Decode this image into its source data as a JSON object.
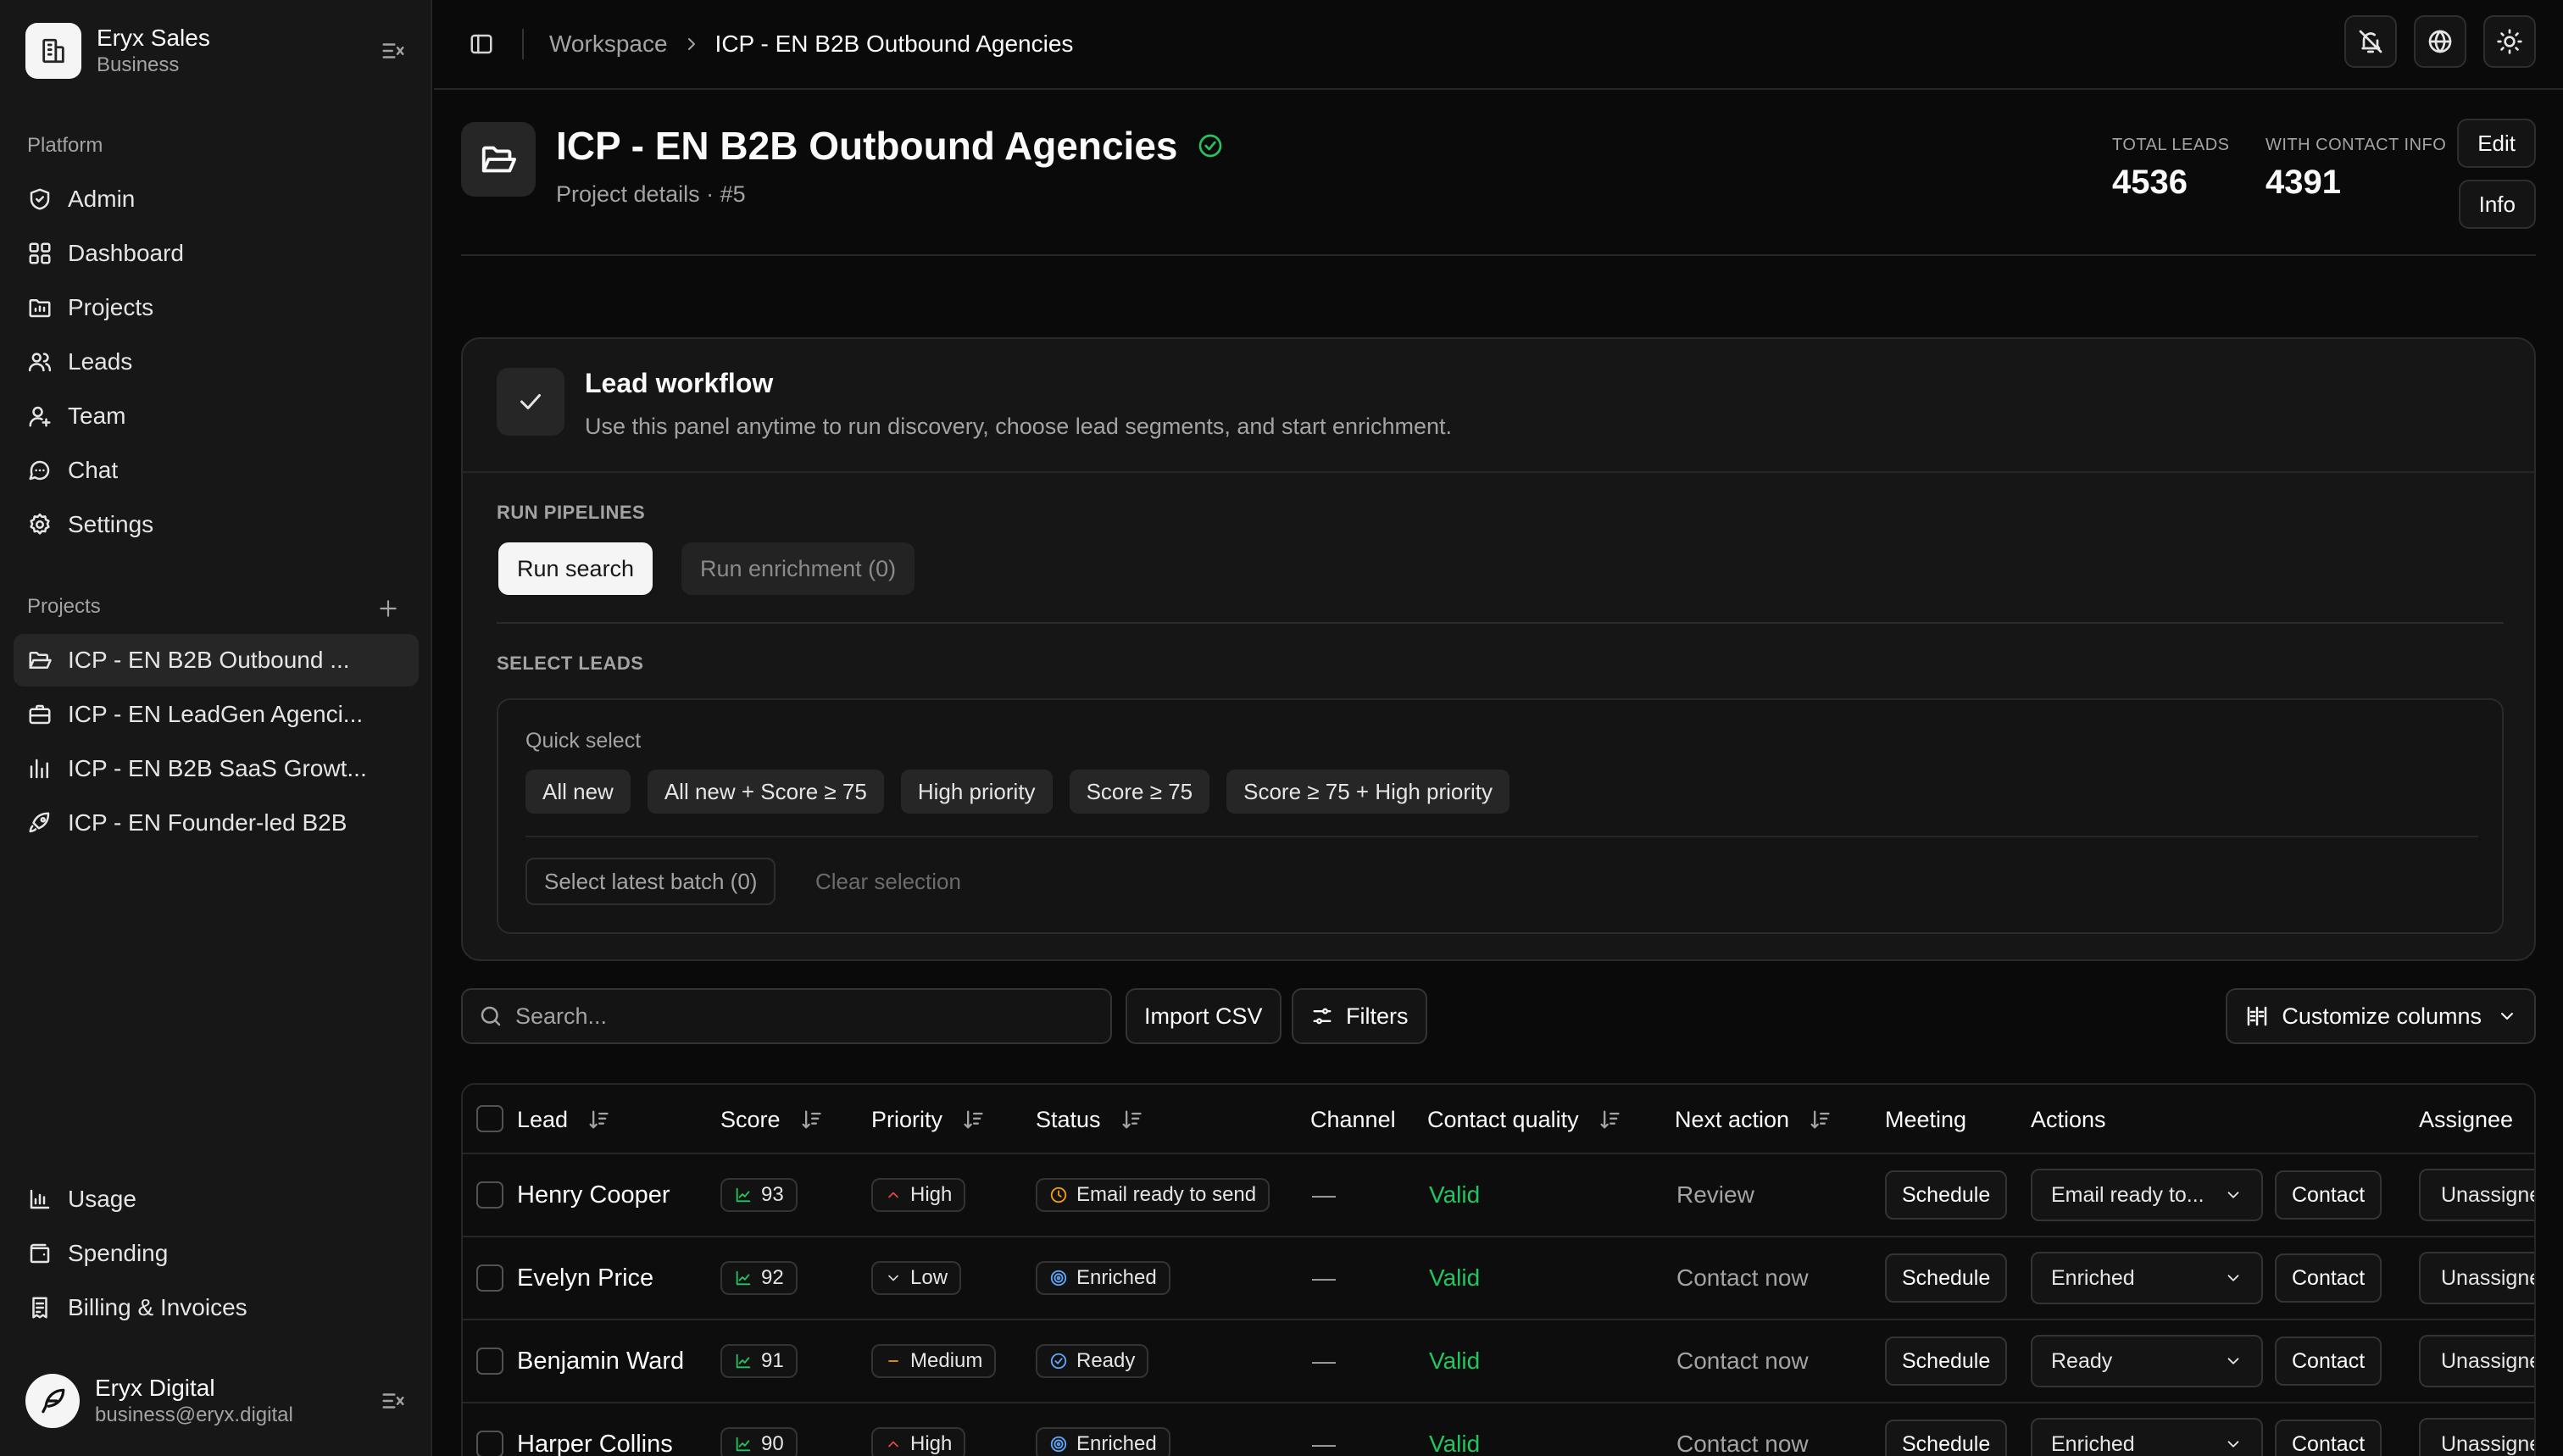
{
  "brand": {
    "name": "Eryx Sales",
    "plan": "Business"
  },
  "platform": {
    "label": "Platform",
    "items": [
      {
        "label": "Admin",
        "icon": "shield-check-icon"
      },
      {
        "label": "Dashboard",
        "icon": "grid-icon"
      },
      {
        "label": "Projects",
        "icon": "folder-icon"
      },
      {
        "label": "Leads",
        "icon": "users-icon"
      },
      {
        "label": "Team",
        "icon": "user-plus-icon"
      },
      {
        "label": "Chat",
        "icon": "chat-icon"
      },
      {
        "label": "Settings",
        "icon": "gear-icon"
      }
    ]
  },
  "projects": {
    "label": "Projects",
    "items": [
      {
        "label": "ICP - EN B2B Outbound ...",
        "icon": "folder-open-icon",
        "active": true
      },
      {
        "label": "ICP - EN LeadGen Agenci...",
        "icon": "briefcase-icon"
      },
      {
        "label": "ICP - EN B2B SaaS Growt...",
        "icon": "bar-chart-icon"
      },
      {
        "label": "ICP - EN Founder-led B2B",
        "icon": "rocket-icon"
      }
    ]
  },
  "bottom_nav": [
    {
      "label": "Usage",
      "icon": "chart-icon"
    },
    {
      "label": "Spending",
      "icon": "wallet-icon"
    },
    {
      "label": "Billing & Invoices",
      "icon": "receipt-icon"
    }
  ],
  "user": {
    "name": "Eryx Digital",
    "email": "business@eryx.digital"
  },
  "breadcrumb": {
    "root": "Workspace",
    "current": "ICP - EN B2B Outbound Agencies"
  },
  "header": {
    "title": "ICP - EN B2B Outbound Agencies",
    "subtitle": "Project details · #5",
    "total_leads_label": "TOTAL LEADS",
    "total_leads": "4536",
    "with_contact_label": "WITH CONTACT INFO",
    "with_contact": "4391",
    "edit_label": "Edit",
    "info_label": "Info"
  },
  "workflow": {
    "title": "Lead workflow",
    "description": "Use this panel anytime to run discovery, choose lead segments, and start enrichment.",
    "run_pipelines_label": "RUN PIPELINES",
    "run_search_label": "Run search",
    "run_enrichment_label": "Run enrichment (0)",
    "select_leads_label": "SELECT LEADS",
    "quick_select_label": "Quick select",
    "chips": [
      "All new",
      "All new + Score ≥ 75",
      "High priority",
      "Score ≥ 75",
      "Score ≥ 75 + High priority"
    ],
    "select_latest_label": "Select latest batch (0)",
    "clear_selection_label": "Clear selection"
  },
  "toolbar": {
    "search_placeholder": "Search...",
    "import_label": "Import CSV",
    "filters_label": "Filters",
    "customize_label": "Customize columns"
  },
  "table": {
    "columns": {
      "lead": "Lead",
      "score": "Score",
      "priority": "Priority",
      "status": "Status",
      "channel": "Channel",
      "contact_quality": "Contact quality",
      "next_action": "Next action",
      "meeting": "Meeting",
      "actions": "Actions",
      "assignee": "Assignee"
    },
    "rows": [
      {
        "name": "Henry Cooper",
        "score": "93",
        "priority": "High",
        "status": "Email ready to send",
        "channel": "—",
        "quality": "Valid",
        "next_action": "Review",
        "meeting": "Schedule",
        "action_select": "Email ready to...",
        "contact": "Contact",
        "assignee": "Unassigned"
      },
      {
        "name": "Evelyn Price",
        "score": "92",
        "priority": "Low",
        "status": "Enriched",
        "channel": "—",
        "quality": "Valid",
        "next_action": "Contact now",
        "meeting": "Schedule",
        "action_select": "Enriched",
        "contact": "Contact",
        "assignee": "Unassigned"
      },
      {
        "name": "Benjamin Ward",
        "score": "91",
        "priority": "Medium",
        "status": "Ready",
        "channel": "—",
        "quality": "Valid",
        "next_action": "Contact now",
        "meeting": "Schedule",
        "action_select": "Ready",
        "contact": "Contact",
        "assignee": "Unassigned"
      },
      {
        "name": "Harper Collins",
        "score": "90",
        "priority": "High",
        "status": "Enriched",
        "channel": "—",
        "quality": "Valid",
        "next_action": "Contact now",
        "meeting": "Schedule",
        "action_select": "Enriched",
        "contact": "Contact",
        "assignee": "Unassigned"
      }
    ]
  },
  "colors": {
    "valid": "#22c55e",
    "status_warn": "#f59e0b",
    "status_info": "#60a5fa",
    "priority_high": "#ef4444"
  }
}
